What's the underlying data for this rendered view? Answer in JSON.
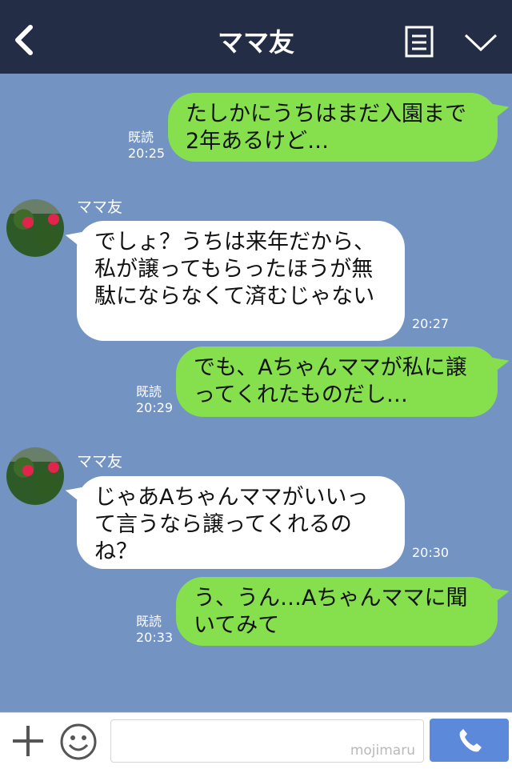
{
  "header": {
    "title": "ママ友"
  },
  "messages": [
    {
      "side": "out",
      "text": "たしかにうちはまだ入園まで2年あるけど…",
      "read": "既読",
      "time": "20:25"
    },
    {
      "side": "in",
      "sender": "ママ友",
      "text": "でしょ？うちは来年だから、私が譲ってもらったほうが無駄にならなくて済むじゃない",
      "time": "20:27"
    },
    {
      "side": "out",
      "text": "でも、Aちゃんママが私に譲ってくれたものだし…",
      "read": "既読",
      "time": "20:29"
    },
    {
      "side": "in",
      "sender": "ママ友",
      "text": "じゃあAちゃんママがいいって言うなら譲ってくれるのね？",
      "time": "20:30"
    },
    {
      "side": "out",
      "text": "う、うん…Aちゃんママに聞いてみて",
      "read": "既読",
      "time": "20:33"
    }
  ],
  "footer": {
    "watermark": "mojimaru"
  },
  "colors": {
    "header_bg": "#232d45",
    "chat_bg": "#7393c3",
    "outgoing_bubble": "#86e04d",
    "incoming_bubble": "#ffffff",
    "send_button": "#5d89da"
  },
  "icons": [
    "back-icon",
    "notes-icon",
    "chevron-down-icon",
    "plus-icon",
    "emoji-icon",
    "phone-icon"
  ]
}
